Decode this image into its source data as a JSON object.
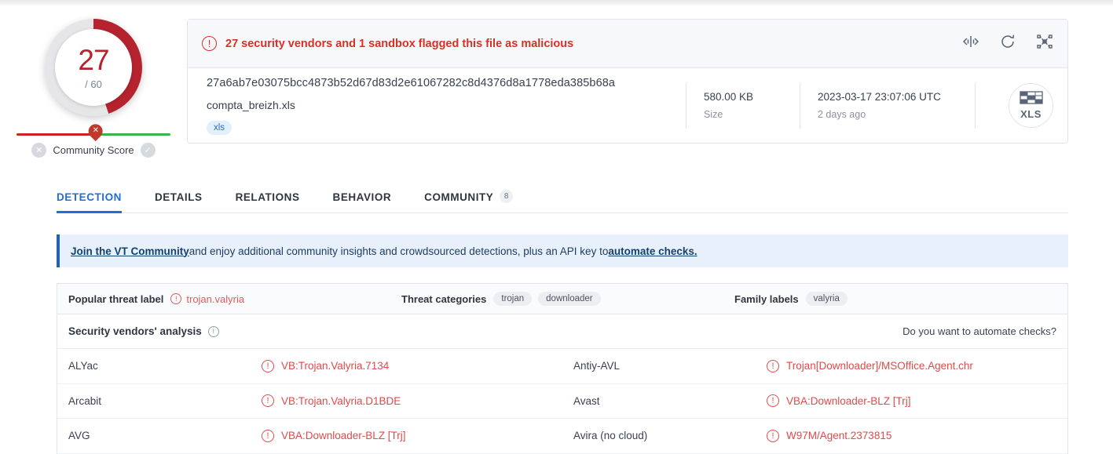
{
  "score": {
    "detections": "27",
    "total": "/ 60"
  },
  "community_score": {
    "label": "Community Score",
    "negative_icon": "✕",
    "positive_icon": "✓",
    "pin_icon": "✕"
  },
  "alert": {
    "icon": "!",
    "message": "27 security vendors and 1 sandbox flagged this file as malicious",
    "actions": [
      {
        "name": "similar-files-icon"
      },
      {
        "name": "reanalyze-icon"
      },
      {
        "name": "graph-icon"
      }
    ]
  },
  "file": {
    "hash": "27a6ab7e03075bcc4873b52d67d83d2e61067282c8d4376d8a1778eda385b68a",
    "name": "compta_breizh.xls",
    "tag": "xls",
    "size_value": "580.00 KB",
    "size_label": "Size",
    "date_value": "2023-03-17 23:07:06 UTC",
    "date_label": "2 days ago",
    "type_label": "XLS"
  },
  "tabs": [
    {
      "label": "DETECTION",
      "active": true
    },
    {
      "label": "DETAILS",
      "active": false
    },
    {
      "label": "RELATIONS",
      "active": false
    },
    {
      "label": "BEHAVIOR",
      "active": false
    },
    {
      "label": "COMMUNITY",
      "active": false,
      "badge": "8"
    }
  ],
  "banner": {
    "link1": "Join the VT Community",
    "middle": " and enjoy additional community insights and crowdsourced detections, plus an API key to ",
    "link2": "automate checks."
  },
  "labels": {
    "threat_label_title": "Popular threat label",
    "threat_label_icon": "!",
    "threat_label_value": "trojan.valyria",
    "threat_categories_title": "Threat categories",
    "threat_categories": [
      "trojan",
      "downloader"
    ],
    "family_labels_title": "Family labels",
    "family_labels": [
      "valyria"
    ]
  },
  "vendors": {
    "title": "Security vendors' analysis",
    "info_icon": "i",
    "automate_text": "Do you want to automate checks?",
    "rows": [
      {
        "left_name": "ALYac",
        "left_result": "VB:Trojan.Valyria.7134",
        "right_name": "Antiy-AVL",
        "right_result": "Trojan[Downloader]/MSOffice.Agent.chr"
      },
      {
        "left_name": "Arcabit",
        "left_result": "VB:Trojan.Valyria.D1BDE",
        "right_name": "Avast",
        "right_result": "VBA:Downloader-BLZ [Trj]"
      },
      {
        "left_name": "AVG",
        "left_result": "VBA:Downloader-BLZ [Trj]",
        "right_name": "Avira (no cloud)",
        "right_result": "W97M/Agent.2373815"
      }
    ]
  },
  "colors": {
    "malicious": "#d93025",
    "accent": "#1f6fd4",
    "gauge": "#b5232f",
    "safe": "#3cb44a"
  }
}
